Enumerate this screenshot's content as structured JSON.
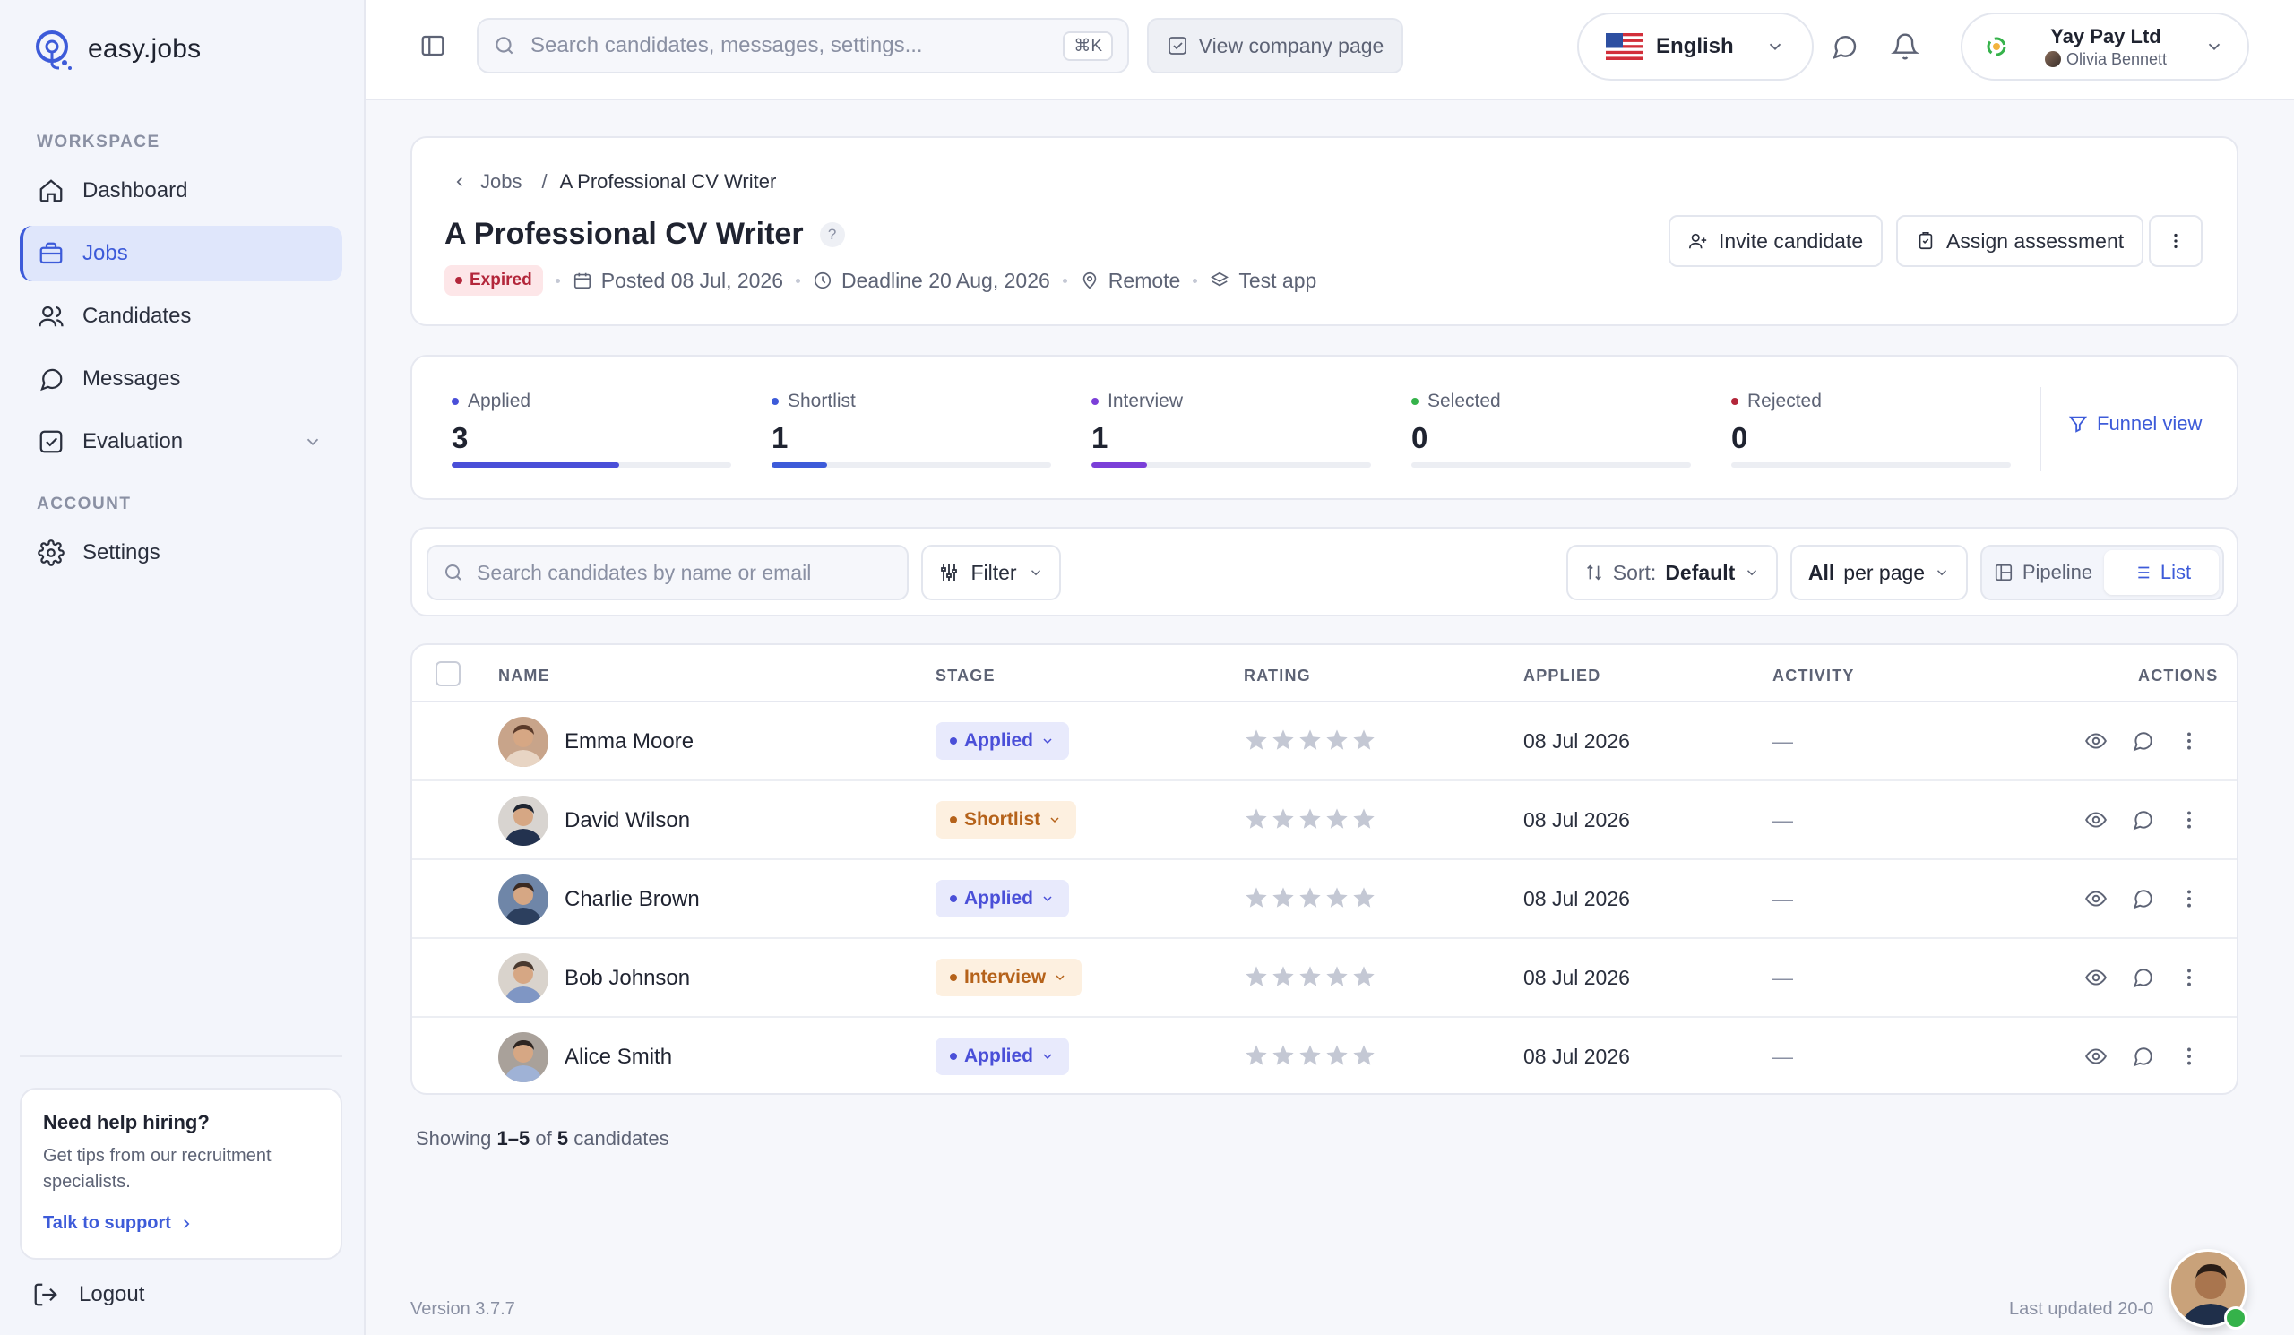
{
  "app": {
    "name": "easy.jobs"
  },
  "sidebar": {
    "workspace_label": "WORKSPACE",
    "account_label": "ACCOUNT",
    "items": [
      {
        "label": "Dashboard",
        "icon": "home-icon"
      },
      {
        "label": "Jobs",
        "icon": "briefcase-icon",
        "active": true
      },
      {
        "label": "Candidates",
        "icon": "users-icon"
      },
      {
        "label": "Messages",
        "icon": "message-icon"
      },
      {
        "label": "Evaluation",
        "icon": "checklist-icon",
        "expandable": true
      }
    ],
    "settings_label": "Settings",
    "help": {
      "title": "Need help hiring?",
      "text": "Get tips from our recruitment specialists.",
      "link": "Talk to support"
    },
    "logout_label": "Logout"
  },
  "header": {
    "search_placeholder": "Search candidates, messages, settings...",
    "search_shortcut": "⌘K",
    "company_page_label": "View company page",
    "language": "English",
    "account": {
      "company": "Yay Pay Ltd",
      "user": "Olivia Bennett"
    }
  },
  "job": {
    "breadcrumb_parent": "Jobs",
    "breadcrumb_sep": "/",
    "breadcrumb_current": "A Professional CV Writer",
    "title": "A Professional CV Writer",
    "help_mark": "?",
    "status": "Expired",
    "posted": "Posted 08 Jul, 2026",
    "deadline": "Deadline 20 Aug, 2026",
    "location": "Remote",
    "app": "Test app",
    "invite_label": "Invite candidate",
    "assess_label": "Assign assessment"
  },
  "stats": [
    {
      "label": "Applied",
      "value": "3",
      "color": "#4a4fd8",
      "fill": 0.6
    },
    {
      "label": "Shortlist",
      "value": "1",
      "color": "#3d5bd9",
      "fill": 0.2
    },
    {
      "label": "Interview",
      "value": "1",
      "color": "#7b3fd8",
      "fill": 0.2
    },
    {
      "label": "Selected",
      "value": "0",
      "color": "#35b24a",
      "fill": 0
    },
    {
      "label": "Rejected",
      "value": "0",
      "color": "#b3263a",
      "fill": 0
    }
  ],
  "funnel_label": "Funnel view",
  "toolbar": {
    "search_placeholder": "Search candidates by name or email",
    "filter_label": "Filter",
    "sort_prefix": "Sort:",
    "sort_value": "Default",
    "perpage_value": "All",
    "perpage_suffix": "per page",
    "view_pipeline": "Pipeline",
    "view_list": "List"
  },
  "table": {
    "headers": {
      "name": "NAME",
      "stage": "STAGE",
      "rating": "RATING",
      "applied": "APPLIED",
      "activity": "ACTIVITY",
      "actions": "ACTIONS"
    },
    "rows": [
      {
        "name": "Emma Moore",
        "stage": "Applied",
        "applied": "08 Jul 2026",
        "activity": "—"
      },
      {
        "name": "David Wilson",
        "stage": "Shortlist",
        "applied": "08 Jul 2026",
        "activity": "—"
      },
      {
        "name": "Charlie Brown",
        "stage": "Applied",
        "applied": "08 Jul 2026",
        "activity": "—"
      },
      {
        "name": "Bob Johnson",
        "stage": "Interview",
        "applied": "08 Jul 2026",
        "activity": "—"
      },
      {
        "name": "Alice Smith",
        "stage": "Applied",
        "applied": "08 Jul 2026",
        "activity": "—"
      }
    ]
  },
  "showing": {
    "prefix": "Showing",
    "range": "1–5",
    "of": "of",
    "total": "5",
    "suffix": "candidates"
  },
  "footer": {
    "version": "Version 3.7.7",
    "last_updated": "Last updated 20-0"
  },
  "colors": {
    "accent": "#3d5bd9",
    "applied_bg": "#e8eafc",
    "applied_fg": "#4a4fd8",
    "shortlist_bg": "#fdf0e0",
    "shortlist_fg": "#b5621a",
    "interview_bg": "#fdf0e0",
    "interview_fg": "#b5621a"
  }
}
